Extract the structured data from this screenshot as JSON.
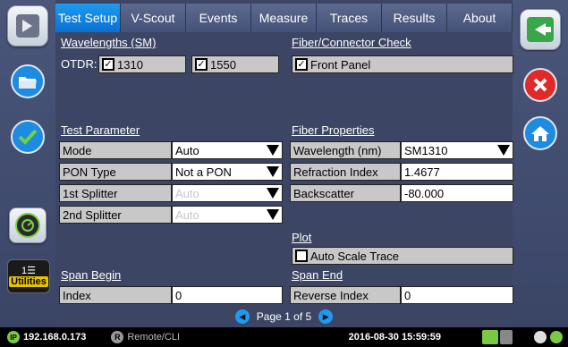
{
  "tabs": [
    "Test Setup",
    "V-Scout",
    "Events",
    "Measure",
    "Traces",
    "Results",
    "About"
  ],
  "wavelengths": {
    "title": "Wavelengths (SM)",
    "otdr_label": "OTDR:",
    "w1": "1310",
    "w2": "1550"
  },
  "fiber_check": {
    "title": "Fiber/Connector Check",
    "item": "Front Panel"
  },
  "test_param": {
    "title": "Test Parameter",
    "rows": [
      {
        "label": "Mode",
        "value": "Auto"
      },
      {
        "label": "PON Type",
        "value": "Not a PON"
      },
      {
        "label": "1st Splitter",
        "value": "Auto"
      },
      {
        "label": "2nd Splitter",
        "value": "Auto"
      }
    ]
  },
  "fiber_props": {
    "title": "Fiber Properties",
    "wavelength_label": "Wavelength (nm)",
    "wavelength_value": "SM1310",
    "refraction_label": "Refraction Index",
    "refraction_value": "1.4677",
    "backscatter_label": "Backscatter",
    "backscatter_value": "-80.000"
  },
  "plot": {
    "title": "Plot",
    "auto_scale": "Auto Scale Trace"
  },
  "span_begin": {
    "title": "Span Begin",
    "label": "Index",
    "value": "0"
  },
  "span_end": {
    "title": "Span End",
    "label": "Reverse Index",
    "value": "0"
  },
  "pager": {
    "text": "Page 1 of 5"
  },
  "utilities_label": "Utilities",
  "status": {
    "ip_badge": "IP",
    "ip": "192.168.0.173",
    "remote_badge": "R",
    "remote": "Remote/CLI",
    "datetime": "2016-08-30 15:59:59"
  }
}
